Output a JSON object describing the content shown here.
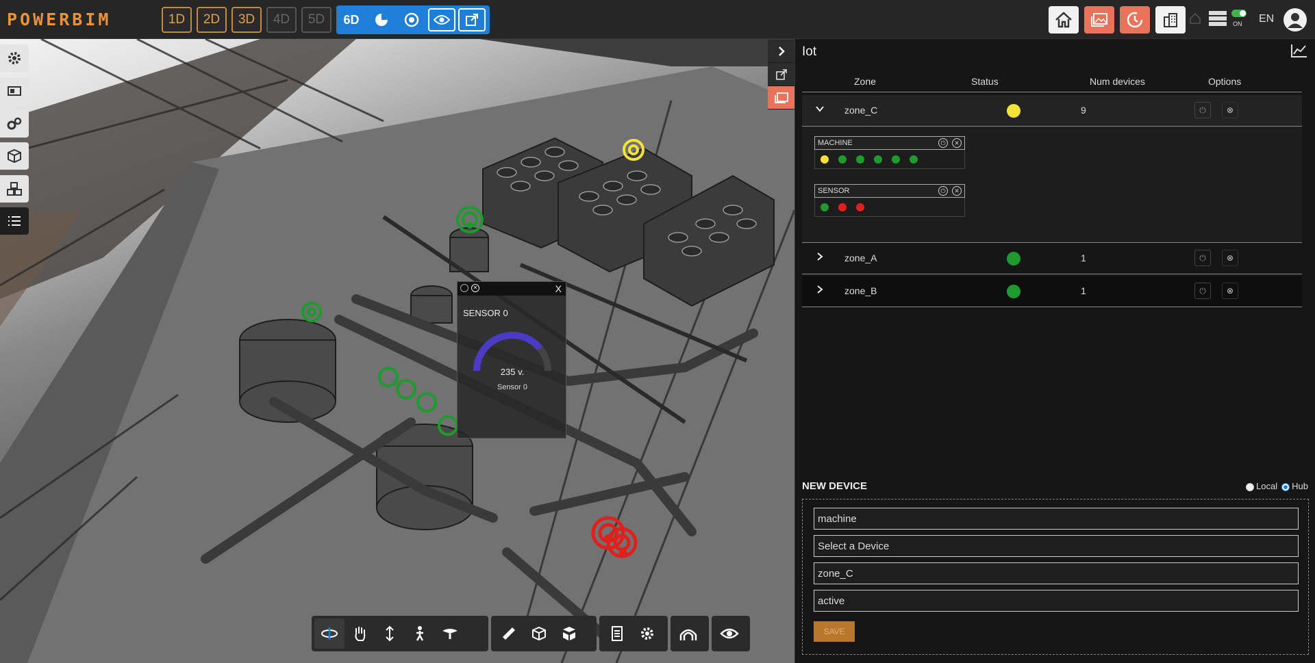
{
  "app": {
    "logo_text": "POWERBIM",
    "dimensions": [
      {
        "label": "1D",
        "enabled": true
      },
      {
        "label": "2D",
        "enabled": true
      },
      {
        "label": "3D",
        "enabled": true
      },
      {
        "label": "4D",
        "enabled": false
      },
      {
        "label": "5D",
        "enabled": false
      }
    ],
    "active_dimension": "6D",
    "server_toggle_label": "ON",
    "language": "EN"
  },
  "colors": {
    "accent_orange": "#e8923b",
    "accent_blue": "#1e7fd8",
    "status_yellow": "#f2e23a",
    "status_green": "#1f9a2e",
    "status_red": "#e0201c"
  },
  "popup": {
    "close_label": "X",
    "title": "SENSOR 0",
    "value": "235 v.",
    "label": "Sensor 0",
    "gauge_fraction": 0.78
  },
  "panel": {
    "title": "Iot",
    "columns": [
      "Zone",
      "Status",
      "Num devices",
      "Options"
    ],
    "zones": [
      {
        "name": "zone_C",
        "status": "yellow",
        "num_devices": "9",
        "expanded": true,
        "groups": [
          {
            "name": "MACHINE",
            "devices": [
              "yellow",
              "green",
              "green",
              "green",
              "green",
              "green"
            ]
          },
          {
            "name": "SENSOR",
            "devices": [
              "green",
              "red",
              "red"
            ]
          }
        ]
      },
      {
        "name": "zone_A",
        "status": "green",
        "num_devices": "1",
        "expanded": false
      },
      {
        "name": "zone_B",
        "status": "green",
        "num_devices": "1",
        "expanded": false
      }
    ]
  },
  "new_device": {
    "title": "NEW DEVICE",
    "mode_options": [
      "Local",
      "Hub"
    ],
    "selected_mode": "Hub",
    "fields": [
      "machine",
      "Select a Device",
      "zone_C",
      "active"
    ],
    "save_label": "SAVE"
  }
}
